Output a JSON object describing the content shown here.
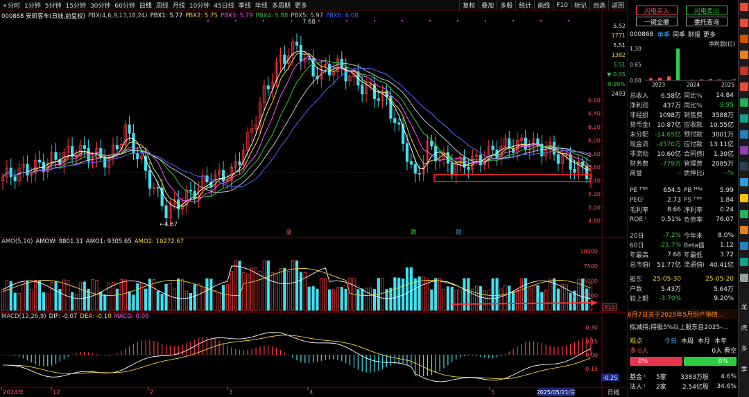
{
  "toolbar": {
    "period_tabs": [
      "分时",
      "1分钟",
      "5分钟",
      "15分钟",
      "30分钟",
      "60分钟",
      "日线",
      "周线",
      "月线",
      "10分钟",
      "45日线",
      "季线",
      "年线",
      "多周期",
      "更多"
    ],
    "active_tab": "日线",
    "buttons": [
      "复权",
      "叠加",
      "多股",
      "统计",
      "画线",
      "F10",
      "标记",
      "自选",
      "返回"
    ]
  },
  "price_panel": {
    "code_name": "000868 安凯客车(日线,前复权)",
    "indicator_name": "PBX(4,6,9,13,18,24)",
    "pbx": [
      {
        "label": "PBX1: 5.77",
        "color": "#ffffff"
      },
      {
        "label": "PBX2: 5.75",
        "color": "#f5d63b"
      },
      {
        "label": "PBX3: 5.79",
        "color": "#ff55ff"
      },
      {
        "label": "PBX4: 5.88",
        "color": "#2ecc40"
      },
      {
        "label": "PBX5: 5.97",
        "color": "#c8c8c8"
      },
      {
        "label": "PBX6: 6.08",
        "color": "#5566ff"
      }
    ],
    "high_label": "7.68",
    "low_label": "4.67",
    "markers": [
      {
        "text": "涨",
        "color": "#ff4d4d"
      },
      {
        "text": "跌",
        "color": "#2ecc40"
      },
      {
        "text": "财",
        "color": "#44aaff"
      }
    ],
    "axis_ticks": [
      "6.60",
      "6.40",
      "6.20",
      "6.00",
      "5.80",
      "5.60",
      "5.40",
      "5.20",
      "5.00",
      "4.80"
    ],
    "axis_top": [
      {
        "text": "5.52",
        "color": "#e0e0e0"
      },
      {
        "text": "1771",
        "color": "#f5d63b"
      },
      {
        "text": "5.51",
        "color": "#e0e0e0"
      },
      {
        "text": "1382",
        "color": "#f5d63b"
      },
      {
        "text": "5.51",
        "color": "#2ecc40"
      },
      {
        "text": "▼-0.05",
        "color": "#2ecc40"
      },
      {
        "text": "-0.90%",
        "color": "#2ecc40"
      },
      {
        "text": "2493",
        "color": "#e0e0e0"
      }
    ]
  },
  "volume_panel": {
    "title": "AMO(5,10)",
    "amow": "AMOW: 8801.31",
    "amo1": "AMO1: 9305.65",
    "amo2": "AMO2: 10272.67",
    "axis_ticks": [
      "10000",
      "7500",
      "5000",
      "2500"
    ],
    "unit_badge": "X10"
  },
  "macd_panel": {
    "title": "MACD(12,26,9)",
    "dif": "DIF: -0.07",
    "dea": "DEA: -0.10",
    "macd": "MACD: 0.06",
    "axis_ticks": [
      "0.30",
      "0.15",
      "0.00",
      "-0.15"
    ],
    "current_badge": "-0.25"
  },
  "date_axis": {
    "labels": [
      "2024年",
      "12",
      "2",
      "3",
      "4",
      "5"
    ],
    "cursor_date": "2025/05/21/三",
    "period_label": "日线"
  },
  "right_panel": {
    "buy_button": "闪电买入",
    "sell_button": "闪电卖出",
    "one_key_button": "一键全撤",
    "query_button": "委托查询",
    "stock_code": "000868",
    "profit_tabs": [
      "单季",
      "同季",
      "财报",
      "更多"
    ],
    "profit_unit": "净利润(亿)",
    "profit_axis": [
      "1.30",
      "0.65",
      "0.00"
    ],
    "profit_years": [
      "2023",
      "2024",
      "2025"
    ],
    "profit_chart": [
      {
        "year": "2023Q1",
        "value": 0.08
      },
      {
        "year": "2023Q2",
        "value": 0.09
      },
      {
        "year": "2023Q3",
        "value": 0.16
      },
      {
        "year": "2023Q4",
        "value": 1.3
      },
      {
        "year": "2024Q1",
        "value": 0.03
      },
      {
        "year": "2024Q2",
        "value": 0.04
      },
      {
        "year": "2024Q3",
        "value": 0.05
      },
      {
        "year": "2024Q4",
        "value": 0.04
      },
      {
        "year": "2025Q1",
        "value": 0.04
      }
    ],
    "finance": [
      [
        "总收入",
        "6.58亿",
        "同比%",
        "14.84"
      ],
      [
        "净利润",
        "437万",
        "同比%",
        "-9.95"
      ],
      [
        "非经损",
        "1098万",
        "销售费",
        "3588万"
      ],
      [
        "货币金i",
        "10.87亿",
        "应收款",
        "10.55亿"
      ],
      [
        "未分配",
        "-14.65亿",
        "预付款",
        "3001万"
      ],
      [
        "现金流",
        "-4570万",
        "应付款",
        "13.11亿"
      ],
      [
        "非流动",
        "10.60亿",
        "合同债i",
        "1.30亿"
      ],
      [
        "财务费",
        "-779万",
        "管理费",
        "2085万"
      ],
      [
        "商誉",
        "--",
        "质押比i",
        "--%"
      ]
    ],
    "valuation": [
      [
        "PE ᵀᵀᴹ",
        "654.5",
        "PB ᴹᴿᵠ",
        "5.99"
      ],
      [
        "PEGⁱ",
        "2.73",
        "PS ᵀᵀᴹ",
        "1.84"
      ],
      [
        "毛利率",
        "8.66",
        "净利率",
        "0.24"
      ],
      [
        "ROE ⁱ",
        "0.51%",
        "负债率",
        "76.07"
      ]
    ],
    "stats": [
      [
        "20日",
        "-7.2%",
        "今年来",
        "8.0%"
      ],
      [
        "60日",
        "-21.7%",
        "Beta值",
        "1.12"
      ],
      [
        "年最高",
        "7.68",
        "年最低",
        "3.72"
      ],
      [
        "总市值i",
        "51.77亿",
        "流通值i",
        "40.41亿"
      ]
    ],
    "holders_label": "股东",
    "holders_date1": "25-05-30",
    "holders_date2": "25-05-20",
    "holders": [
      [
        "户数",
        "5.43万",
        "",
        "5.64万"
      ],
      [
        "较上期",
        "-3.70%",
        "",
        "9.20%"
      ]
    ],
    "news1": "6月7日关于2025年5月份产销情...",
    "news2": "拟减持:持股5%以上股东自2025-...",
    "view_label": "观点",
    "view_tabs": [
      "今日",
      "本周",
      "本月",
      "本年"
    ],
    "bull_label": "多 0人",
    "bear_label": "0人 看空",
    "bull_pct": "0%",
    "bear_pct": "0%",
    "funds": [
      [
        "基金 ⁱ",
        "5家",
        "3383万股",
        "4.6%"
      ],
      [
        "法人 ⁱ",
        "2家",
        "2.54亿股",
        "34.6%"
      ]
    ]
  },
  "side_icons": [
    {
      "name": "eye-icon",
      "color": "#e74c3c"
    },
    {
      "name": "flag-icon",
      "color": "#e74c3c"
    },
    {
      "name": "bell-icon",
      "color": "#d35400"
    },
    {
      "name": "list-icon",
      "color": "#e67e22"
    },
    {
      "name": "doc-icon",
      "color": "#c0392b"
    },
    {
      "name": "k-icon",
      "color": "#e74c3c"
    },
    {
      "name": "grid-icon",
      "color": "#27ae60"
    },
    {
      "name": "chart-icon",
      "color": "#16a085"
    },
    {
      "name": "table-icon",
      "color": "#2980b9"
    },
    {
      "name": "bookmark-icon",
      "color": "#8e44ad"
    },
    {
      "name": "star-icon",
      "color": "#2c3e50"
    },
    {
      "name": "rsi-icon",
      "color": "#3498db"
    },
    {
      "name": "pen-icon",
      "color": "#f1c40f"
    },
    {
      "name": "table2-icon",
      "color": "#27ae60"
    },
    {
      "name": "edit-icon",
      "color": "#e67e22"
    },
    {
      "name": "f10-icon",
      "color": "#2980b9"
    },
    {
      "name": "mail-icon",
      "color": "#16a085"
    },
    {
      "name": "ruler-icon",
      "color": "#95a5a6"
    }
  ],
  "side_text": [
    "龙",
    "虎",
    "多",
    "季"
  ]
}
